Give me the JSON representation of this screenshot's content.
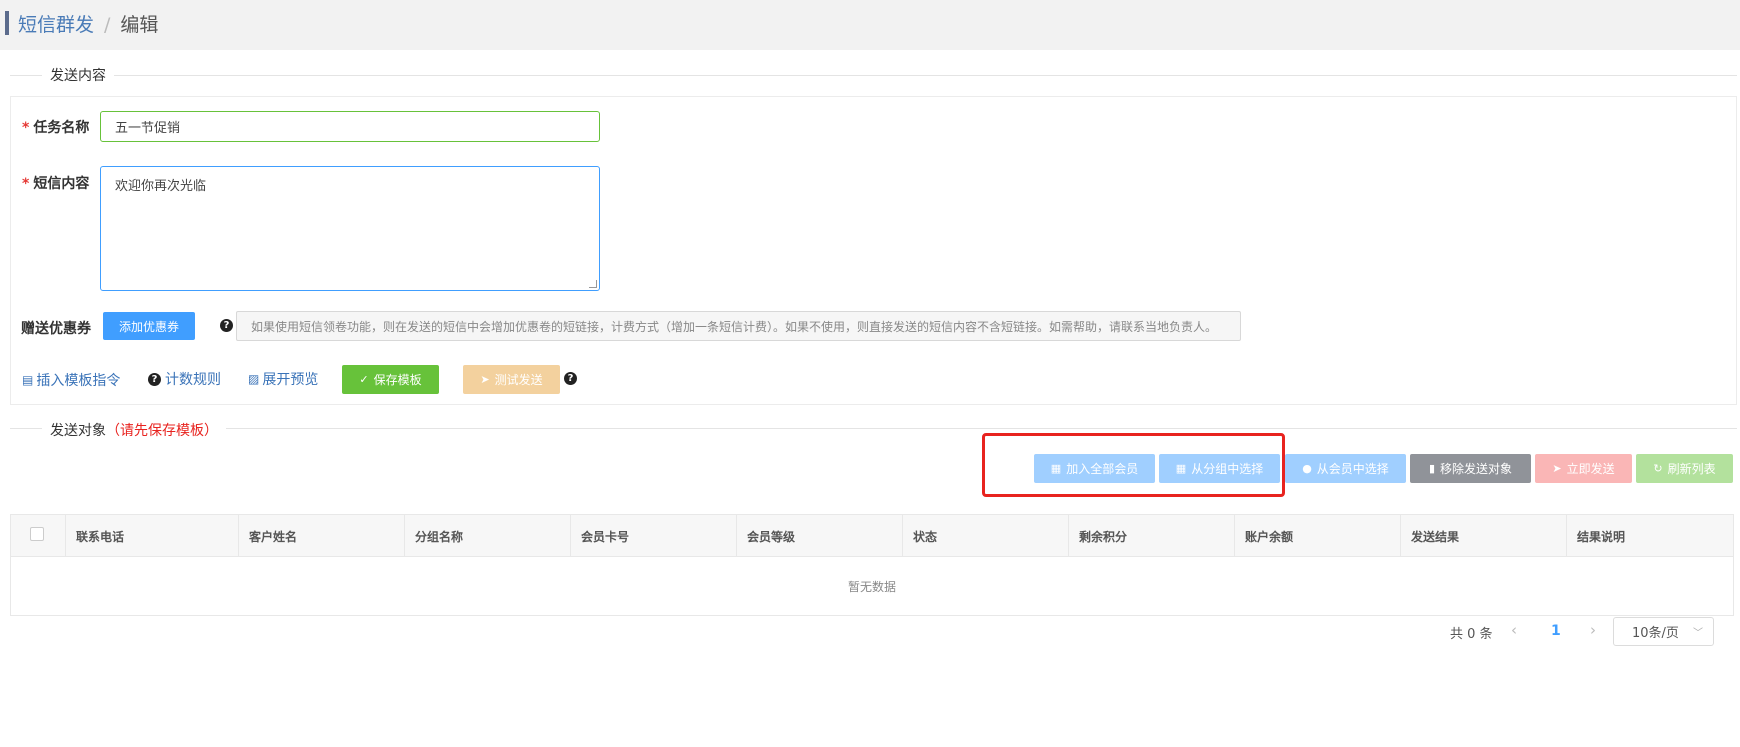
{
  "breadcrumb": {
    "parent": "短信群发",
    "separator": "/",
    "current": "编辑"
  },
  "send_content_section": {
    "title": "发送内容"
  },
  "form": {
    "task_name_label": "任务名称",
    "task_name_value": "五一节促销",
    "sms_content_label": "短信内容",
    "sms_content_value": "欢迎你再次光临",
    "coupon_label": "赠送优惠券",
    "add_coupon_button": "添加优惠券",
    "coupon_hint": "如果使用短信领卷功能，则在发送的短信中会增加优惠卷的短链接，计费方式（增加一条短信计费）。如果不使用，则直接发送的短信内容不含短链接。如需帮助，请联系当地负责人。"
  },
  "actions": {
    "insert_template": "插入模板指令",
    "count_rules": "计数规则",
    "expand_preview": "展开预览",
    "save_template": "保存模板",
    "test_send": "测试发送"
  },
  "send_target_section": {
    "title": "发送对象",
    "warning": "（请先保存模板）"
  },
  "target_buttons": {
    "add_all_members": "加入全部会员",
    "select_from_group": "从分组中选择",
    "select_from_members": "从会员中选择",
    "remove_targets": "移除发送对象",
    "send_now": "立即发送",
    "refresh_list": "刷新列表"
  },
  "table": {
    "columns": [
      "联系电话",
      "客户姓名",
      "分组名称",
      "会员卡号",
      "会员等级",
      "状态",
      "剩余积分",
      "账户余额",
      "发送结果",
      "结果说明"
    ],
    "empty_text": "暂无数据"
  },
  "pagination": {
    "total": "共 0 条",
    "current_page": "1",
    "page_size": "10条/页"
  },
  "colors": {
    "primary_light": "#a0cfff",
    "success": "#67c23a",
    "info_dark": "#909399",
    "warning_light": "#f3d19e",
    "danger_light": "#fab6b6",
    "success_light": "#b3e19d",
    "highlight_red": "#e8231f"
  }
}
